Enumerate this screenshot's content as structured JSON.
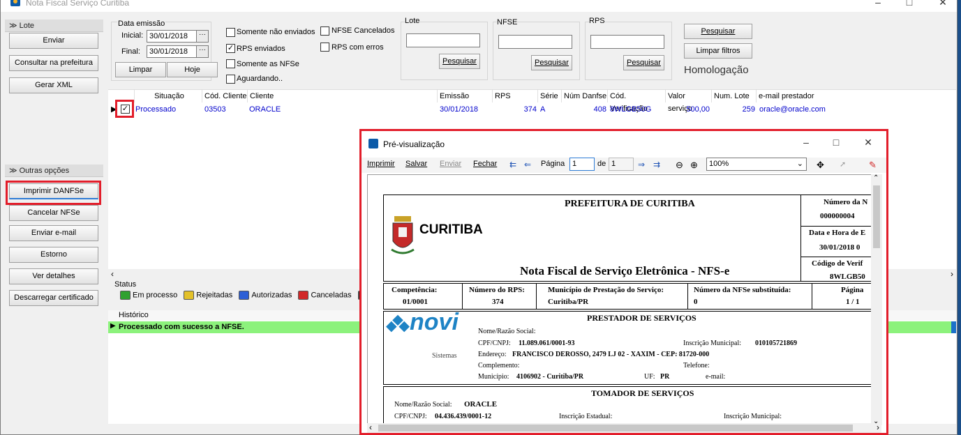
{
  "window": {
    "title": "Nota Fiscal Serviço Curitiba"
  },
  "sidebar": {
    "lote_header": "Lote",
    "lote_buttons": [
      "Enviar",
      "Consultar na prefeitura",
      "Gerar XML"
    ],
    "outras_header": "Outras opções",
    "outras_buttons": [
      "Imprimir DANFSe",
      "Cancelar NFSe",
      "Enviar e-mail",
      "Estorno",
      "Ver detalhes",
      "Descarregar certificado"
    ]
  },
  "filters": {
    "data_emissao_label": "Data emissão",
    "inicial_label": "Inicial:",
    "inicial_value": "30/01/2018",
    "final_label": "Final:",
    "final_value": "30/01/2018",
    "limpar": "Limpar",
    "hoje": "Hoje",
    "checkboxes": [
      {
        "label": "Somente não enviados",
        "checked": false
      },
      {
        "label": "RPS enviados",
        "checked": true
      },
      {
        "label": "Somente as NFSe",
        "checked": false
      },
      {
        "label": "Aguardando..",
        "checked": false
      },
      {
        "label": "NFSE Cancelados",
        "checked": false
      },
      {
        "label": "RPS com erros",
        "checked": false
      }
    ],
    "lote_label": "Lote",
    "nfse_label": "NFSE",
    "rps_label": "RPS",
    "pesquisar": "Pesquisar",
    "limpar_filtros": "Limpar filtros",
    "ambiente": "Homologação"
  },
  "grid": {
    "columns": [
      "Situação",
      "Cód. Cliente",
      "Cliente",
      "Emissão",
      "RPS",
      "Série",
      "Núm Danfse",
      "Cód. Verificação",
      "Valor serviço",
      "Num. Lote",
      "e-mail prestador"
    ],
    "row": [
      "Processado",
      "03503",
      "ORACLE",
      "30/01/2018",
      "374",
      "A",
      "408",
      "8WLGB50G",
      "500,00",
      "259",
      "oracle@oracle.com"
    ]
  },
  "status": {
    "label": "Status",
    "items": [
      {
        "label": "Em processo",
        "color": "#2fa12f"
      },
      {
        "label": "Rejeitadas",
        "color": "#e3c12a"
      },
      {
        "label": "Autorizadas",
        "color": "#2d5fd6"
      },
      {
        "label": "Canceladas",
        "color": "#d12828"
      },
      {
        "label": "",
        "color": "#222222"
      }
    ]
  },
  "historico": {
    "label": "Histórico",
    "row": "Processado com sucesso a NFSE."
  },
  "preview": {
    "title": "Pré-visualização",
    "toolbar": {
      "imprimir": "Imprimir",
      "salvar": "Salvar",
      "enviar": "Enviar",
      "fechar": "Fechar",
      "pagina": "Página",
      "page": "1",
      "de": "de",
      "total": "1",
      "zoom": "100%"
    },
    "doc": {
      "prefeitura": "PREFEITURA DE CURITIBA",
      "city_logo": "CURITIBA",
      "titulo": "Nota Fiscal de Serviço Eletrônica - NFS-e",
      "numero_label": "Número da N",
      "numero_value": "000000004",
      "data_label": "Data e Hora de E",
      "data_value": "30/01/2018 0",
      "codigo_label": "Código de Verif",
      "codigo_value": "8WLGB50",
      "competencia_label": "Competência:",
      "competencia_value": "01/0001",
      "rps_label": "Número do RPS:",
      "rps_value": "374",
      "municipio_label": "Município de Prestação do Serviço:",
      "municipio_value": "Curitiba/PR",
      "substituida_label": "Número da NFSe substituída:",
      "substituida_value": "0",
      "pagina_label": "Página",
      "pagina_value": "1  /  1",
      "prestador_header": "PRESTADOR DE SERVIÇOS",
      "novi_logo": "novi",
      "novi_sub": "Sistemas",
      "nome_label": "Nome/Razão Social:",
      "cpf_label": "CPF/CNPJ:",
      "cpf_value": "11.089.061/0001-93",
      "im_label": "Inscrição Municipal:",
      "im_value": "010105721869",
      "endereco_label": "Endereço:",
      "endereco_value": "FRANCISCO DEROSSO, 2479 LJ 02 - XAXIM - CEP: 81720-000",
      "complemento_label": "Complemento:",
      "telefone_label": "Telefone:",
      "municipio2_label": "Município:",
      "municipio2_value": "4106902 - Curitiba/PR",
      "uf_label": "UF:",
      "uf_value": "PR",
      "email_label": "e-mail:",
      "tomador_header": "TOMADOR DE SERVIÇOS",
      "t_nome_label": "Nome/Razão Social:",
      "t_nome_value": "ORACLE",
      "t_cpf_label": "CPF/CNPJ:",
      "t_cpf_value": "04.436.439/0001-12",
      "t_ie_label": "Inscrição Estadual:",
      "t_im_label": "Inscrição Municipal:"
    }
  }
}
